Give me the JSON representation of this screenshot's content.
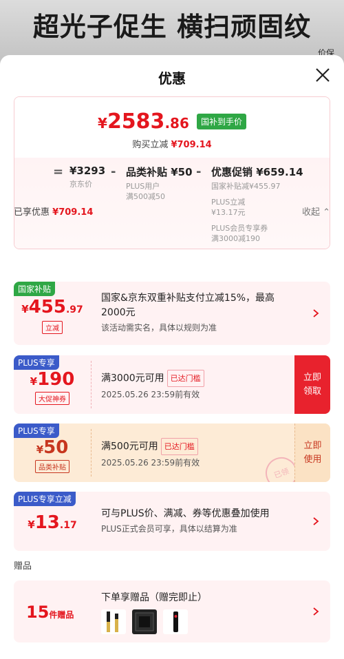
{
  "banner": {
    "text": "超光子促生 横扫顽固纹",
    "corner_text": "价保"
  },
  "sheet": {
    "title": "优惠"
  },
  "summary": {
    "price_currency": "¥",
    "price_int": "2583",
    "price_dec": ".86",
    "price_tag": "国补到手价",
    "saving_label": "购买立减",
    "saving_value": "¥709.14",
    "jd_price": "¥3293",
    "jd_price_label": "京东价",
    "category_subsidy": "品类补贴",
    "category_subsidy_value": "¥50",
    "category_subsidy_note1": "PLUS用户",
    "category_subsidy_note2": "满500减50",
    "promo": "优惠促销",
    "promo_value": "¥659.14",
    "promo_note1": "国家补贴减¥455.97",
    "promo_note2": "PLUS立减",
    "promo_note3": "¥13.17元",
    "promo_note4": "PLUS会员专享券",
    "promo_note5": "满3000减190"
  },
  "enjoyed": {
    "label": "已享优惠",
    "value": "¥709.14",
    "collapse": "收起"
  },
  "cards": [
    {
      "badge": "国家补贴",
      "cur": "¥",
      "int": "455",
      "dec": ".97",
      "tag": "立减",
      "title": "国家&京东双重补贴支付立减15%，最高2000元",
      "desc": "该活动需实名，具体以规则为准"
    },
    {
      "badge": "PLUS专享",
      "cur": "¥",
      "int": "190",
      "dec": "",
      "tag": "大促神券",
      "title": "满3000元可用",
      "reached": "已达门槛",
      "desc": "2025.05.26 23:59前有效",
      "button": "立即领取"
    },
    {
      "badge": "PLUS专享",
      "cur": "¥",
      "int": "50",
      "dec": "",
      "tag": "品类补贴",
      "title": "满500元可用",
      "reached": "已达门槛",
      "desc": "2025.05.26 23:59前有效",
      "button": "立即使用",
      "stamp": "已领"
    },
    {
      "badge": "PLUS专享立减",
      "cur": "¥",
      "int": "13",
      "dec": ".17",
      "title": "可与PLUS价、满减、券等优惠叠加使用",
      "desc": "PLUS正式会员可享，具体以结算为准"
    }
  ],
  "gift": {
    "label": "赠品",
    "count": "15",
    "unit": "件赠品",
    "title": "下单享赠品（赠完即止）"
  },
  "colors": {
    "accent": "#e4161e",
    "green": "#2fa745",
    "plus_blue": "#3b5bc9"
  }
}
